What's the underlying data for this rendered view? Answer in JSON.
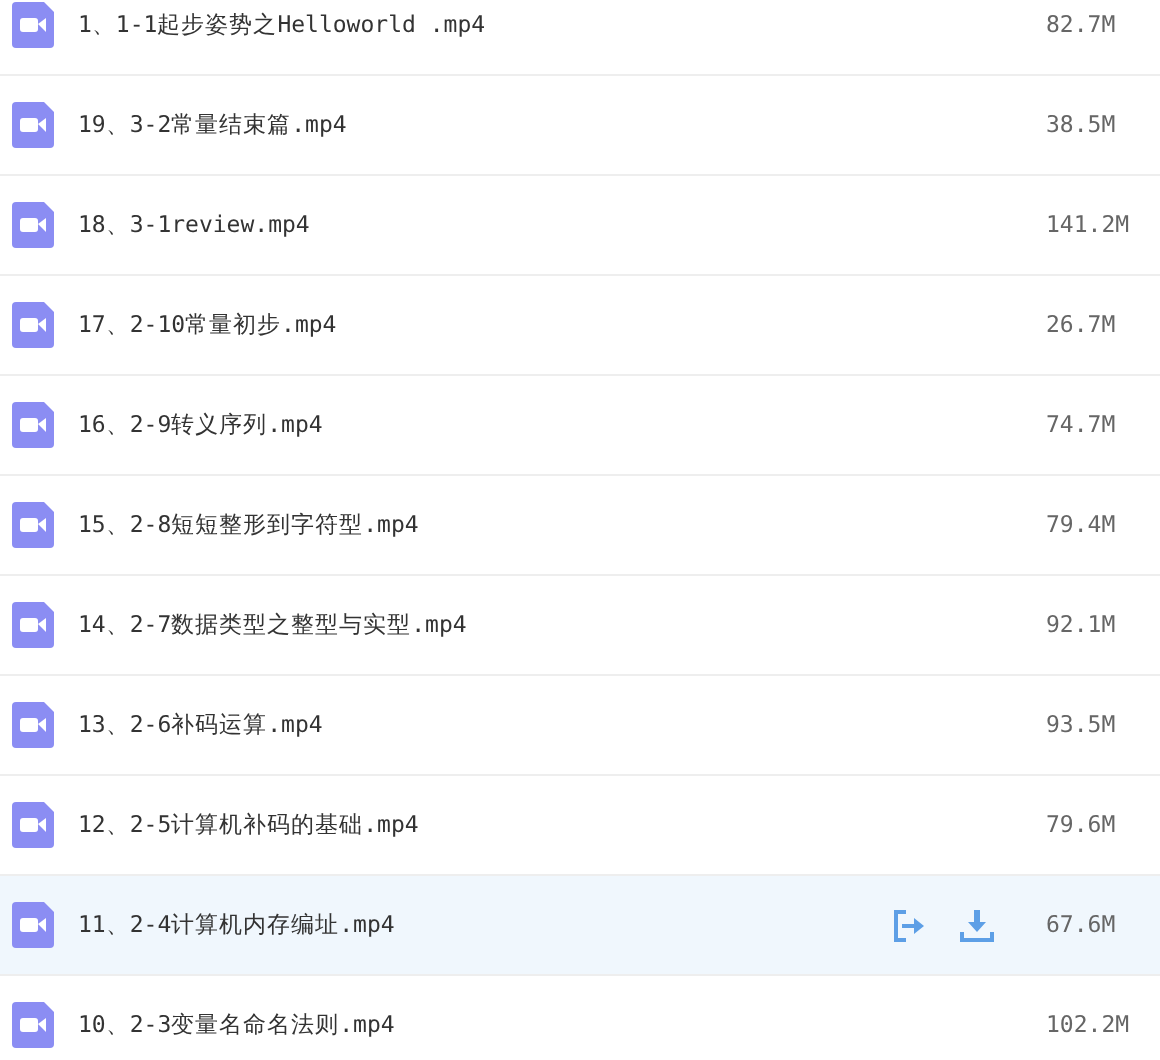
{
  "files": [
    {
      "name": "1、1-1起步姿势之Helloworld .mp4",
      "size": "82.7M",
      "hovered": false
    },
    {
      "name": "19、3-2常量结束篇.mp4",
      "size": "38.5M",
      "hovered": false
    },
    {
      "name": "18、3-1review.mp4",
      "size": "141.2M",
      "hovered": false
    },
    {
      "name": "17、2-10常量初步.mp4",
      "size": "26.7M",
      "hovered": false
    },
    {
      "name": "16、2-9转义序列.mp4",
      "size": "74.7M",
      "hovered": false
    },
    {
      "name": "15、2-8短短整形到字符型.mp4",
      "size": "79.4M",
      "hovered": false
    },
    {
      "name": "14、2-7数据类型之整型与实型.mp4",
      "size": "92.1M",
      "hovered": false
    },
    {
      "name": "13、2-6补码运算.mp4",
      "size": "93.5M",
      "hovered": false
    },
    {
      "name": "12、2-5计算机补码的基础.mp4",
      "size": "79.6M",
      "hovered": false
    },
    {
      "name": "11、2-4计算机内存编址.mp4",
      "size": "67.6M",
      "hovered": true
    },
    {
      "name": "10、2-3变量名命名法则.mp4",
      "size": "102.2M",
      "hovered": false
    }
  ]
}
